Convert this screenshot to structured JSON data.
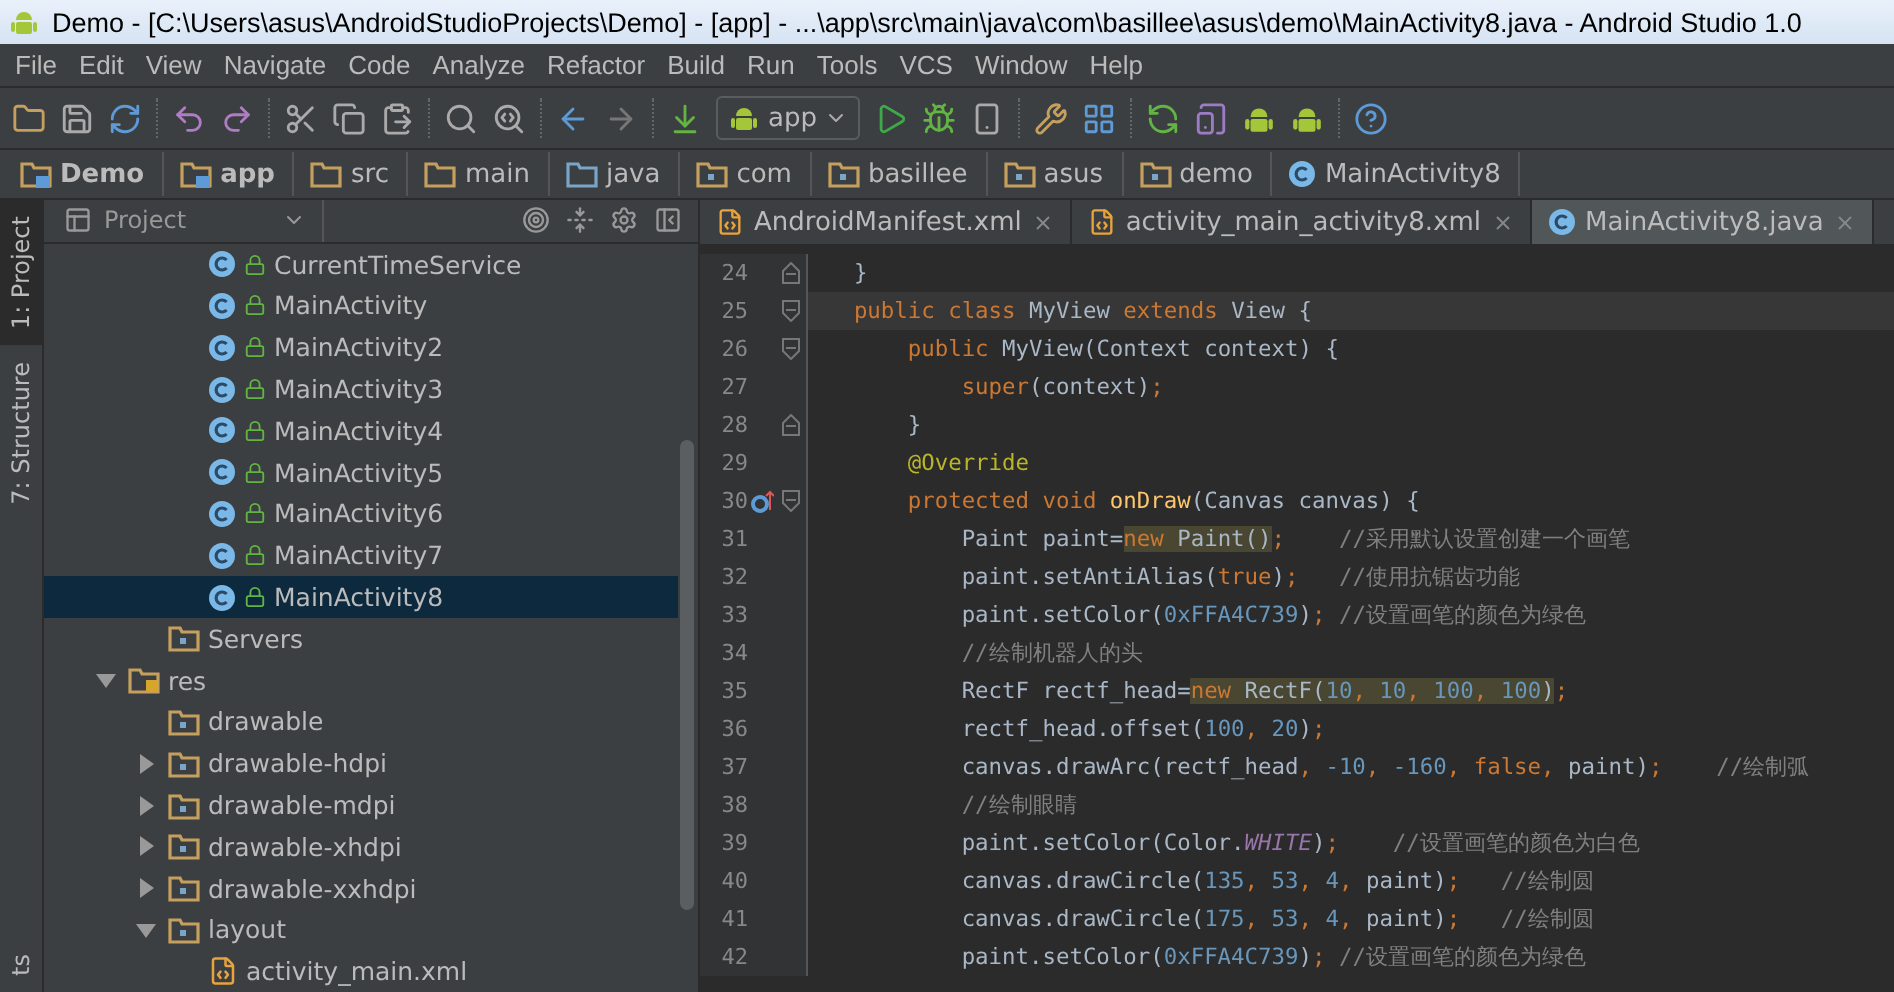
{
  "window": {
    "title": "Demo - [C:\\Users\\asus\\AndroidStudioProjects\\Demo] - [app] - ...\\app\\src\\main\\java\\com\\basillee\\asus\\demo\\MainActivity8.java - Android Studio 1.0"
  },
  "menu": [
    "File",
    "Edit",
    "View",
    "Navigate",
    "Code",
    "Analyze",
    "Refactor",
    "Build",
    "Run",
    "Tools",
    "VCS",
    "Window",
    "Help"
  ],
  "toolbar": {
    "run_config": "app"
  },
  "breadcrumbs": [
    {
      "label": "Demo",
      "kind": "module"
    },
    {
      "label": "app",
      "kind": "module"
    },
    {
      "label": "src",
      "kind": "folder"
    },
    {
      "label": "main",
      "kind": "folder"
    },
    {
      "label": "java",
      "kind": "source"
    },
    {
      "label": "com",
      "kind": "package"
    },
    {
      "label": "basillee",
      "kind": "package"
    },
    {
      "label": "asus",
      "kind": "package"
    },
    {
      "label": "demo",
      "kind": "package"
    },
    {
      "label": "MainActivity8",
      "kind": "class"
    }
  ],
  "tool_windows": [
    {
      "label": "1: Project",
      "selected": true
    },
    {
      "label": "7: Structure",
      "selected": false
    }
  ],
  "bottom_tool_windows": [
    {
      "label": "ts",
      "selected": false
    }
  ],
  "project_panel": {
    "title": "Project",
    "tree": [
      {
        "kind": "cut_off",
        "children": [
          {
            "kind": "cut_off",
            "children": [
              {
                "label": "CurrentTimeService",
                "kind": "class",
                "selected": false
              },
              {
                "label": "MainActivity",
                "kind": "class",
                "selected": false
              },
              {
                "label": "MainActivity2",
                "kind": "class",
                "selected": false
              },
              {
                "label": "MainActivity3",
                "kind": "class",
                "selected": false
              },
              {
                "label": "MainActivity4",
                "kind": "class",
                "selected": false
              },
              {
                "label": "MainActivity5",
                "kind": "class",
                "selected": false
              },
              {
                "label": "MainActivity6",
                "kind": "class",
                "selected": false
              },
              {
                "label": "MainActivity7",
                "kind": "class",
                "selected": false
              },
              {
                "label": "MainActivity8",
                "kind": "class",
                "selected": true
              }
            ]
          },
          {
            "label": "Servers",
            "kind": "package",
            "selected": false
          }
        ]
      },
      {
        "label": "res",
        "kind": "res",
        "expanded": true,
        "selected": false,
        "children": [
          {
            "label": "drawable",
            "kind": "package",
            "selected": false
          },
          {
            "label": "drawable-hdpi",
            "kind": "package",
            "expanded": false,
            "selected": false
          },
          {
            "label": "drawable-mdpi",
            "kind": "package",
            "expanded": false,
            "selected": false
          },
          {
            "label": "drawable-xhdpi",
            "kind": "package",
            "expanded": false,
            "selected": false
          },
          {
            "label": "drawable-xxhdpi",
            "kind": "package",
            "expanded": false,
            "selected": false
          },
          {
            "label": "layout",
            "kind": "package",
            "expanded": true,
            "selected": false,
            "children": [
              {
                "label": "activity_main.xml",
                "kind": "xml",
                "selected": false
              }
            ]
          }
        ]
      }
    ]
  },
  "editor": {
    "tabs": [
      {
        "label": "AndroidManifest.xml",
        "kind": "xml",
        "selected": false
      },
      {
        "label": "activity_main_activity8.xml",
        "kind": "xml",
        "selected": false
      },
      {
        "label": "MainActivity8.java",
        "kind": "class",
        "selected": true
      }
    ],
    "lines": [
      {
        "number": "24",
        "fold_start": false,
        "override": false,
        "current": false,
        "segments": [
          {
            "t": "    }",
            "kind": "plain"
          }
        ]
      },
      {
        "number": "25",
        "fold_start": true,
        "override": false,
        "current": true,
        "segments": [
          {
            "t": "    public class ",
            "kind": "kw"
          },
          {
            "t": "MyView",
            "kind": "plain"
          },
          {
            "t": " extends ",
            "kind": "kw"
          },
          {
            "t": "View {",
            "kind": "plain"
          }
        ]
      },
      {
        "number": "26",
        "fold_start": true,
        "override": false,
        "current": false,
        "segments": [
          {
            "t": "        public ",
            "kind": "kw"
          },
          {
            "t": "MyView(Context context) {",
            "kind": "plain"
          }
        ]
      },
      {
        "number": "27",
        "override": false,
        "current": false,
        "segments": [
          {
            "t": "            super",
            "kind": "kw"
          },
          {
            "t": "(context)",
            "kind": "plain"
          },
          {
            "t": ";",
            "kind": "kw"
          }
        ]
      },
      {
        "number": "28",
        "fold_start": false,
        "override": false,
        "current": false,
        "segments": [
          {
            "t": "        }",
            "kind": "plain"
          }
        ]
      },
      {
        "number": "29",
        "override": false,
        "current": false,
        "segments": [
          {
            "t": "        @Override",
            "kind": "anno"
          }
        ]
      },
      {
        "number": "30",
        "fold_start": true,
        "override": true,
        "current": false,
        "segments": [
          {
            "t": "        protected void ",
            "kind": "kw"
          },
          {
            "t": "onDraw",
            "kind": "method"
          },
          {
            "t": "(Canvas canvas) {",
            "kind": "plain"
          }
        ]
      },
      {
        "number": "31",
        "override": false,
        "current": false,
        "segments": [
          {
            "t": "            Paint paint=",
            "kind": "plain"
          },
          {
            "t": "new ",
            "kind": "hl_kw"
          },
          {
            "t": "Paint()",
            "kind": "hl_plain"
          },
          {
            "t": ";",
            "kind": "kw"
          },
          {
            "t": "    //采用默认设置创建一个画笔",
            "kind": "comment"
          }
        ]
      },
      {
        "number": "32",
        "override": false,
        "current": false,
        "segments": [
          {
            "t": "            paint.setAntiAlias(",
            "kind": "plain"
          },
          {
            "t": "true",
            "kind": "kw"
          },
          {
            "t": ")",
            "kind": "plain"
          },
          {
            "t": ";",
            "kind": "kw"
          },
          {
            "t": "   //使用抗锯齿功能",
            "kind": "comment"
          }
        ]
      },
      {
        "number": "33",
        "override": false,
        "current": false,
        "segments": [
          {
            "t": "            paint.setColor(",
            "kind": "plain"
          },
          {
            "t": "0xFFA4C739",
            "kind": "num"
          },
          {
            "t": ")",
            "kind": "plain"
          },
          {
            "t": ";",
            "kind": "kw"
          },
          {
            "t": " //设置画笔的颜色为绿色",
            "kind": "comment"
          }
        ]
      },
      {
        "number": "34",
        "override": false,
        "current": false,
        "segments": [
          {
            "t": "            //绘制机器人的头",
            "kind": "comment"
          }
        ]
      },
      {
        "number": "35",
        "override": false,
        "current": false,
        "segments": [
          {
            "t": "            RectF rectf_head=",
            "kind": "plain"
          },
          {
            "t": "new ",
            "kind": "hl_kw"
          },
          {
            "t": "RectF(",
            "kind": "hl_plain"
          },
          {
            "t": "10",
            "kind": "hl_num"
          },
          {
            "t": ", ",
            "kind": "hl_kw"
          },
          {
            "t": "10",
            "kind": "hl_num"
          },
          {
            "t": ", ",
            "kind": "hl_kw"
          },
          {
            "t": "100",
            "kind": "hl_num"
          },
          {
            "t": ", ",
            "kind": "hl_kw"
          },
          {
            "t": "100",
            "kind": "hl_num"
          },
          {
            "t": ")",
            "kind": "hl_plain"
          },
          {
            "t": ";",
            "kind": "kw"
          }
        ]
      },
      {
        "number": "36",
        "override": false,
        "current": false,
        "segments": [
          {
            "t": "            rectf_head.offset(",
            "kind": "plain"
          },
          {
            "t": "100",
            "kind": "num"
          },
          {
            "t": ", ",
            "kind": "kw"
          },
          {
            "t": "20",
            "kind": "num"
          },
          {
            "t": ")",
            "kind": "plain"
          },
          {
            "t": ";",
            "kind": "kw"
          }
        ]
      },
      {
        "number": "37",
        "override": false,
        "current": false,
        "segments": [
          {
            "t": "            canvas.drawArc(rectf_head",
            "kind": "plain"
          },
          {
            "t": ", ",
            "kind": "kw"
          },
          {
            "t": "-10",
            "kind": "num"
          },
          {
            "t": ", ",
            "kind": "kw"
          },
          {
            "t": "-160",
            "kind": "num"
          },
          {
            "t": ", ",
            "kind": "kw"
          },
          {
            "t": "false",
            "kind": "kw"
          },
          {
            "t": ", ",
            "kind": "kw"
          },
          {
            "t": "paint)",
            "kind": "plain"
          },
          {
            "t": ";",
            "kind": "kw"
          },
          {
            "t": "    //绘制弧",
            "kind": "comment"
          }
        ]
      },
      {
        "number": "38",
        "override": false,
        "current": false,
        "segments": [
          {
            "t": "            //绘制眼睛",
            "kind": "comment"
          }
        ]
      },
      {
        "number": "39",
        "override": false,
        "current": false,
        "segments": [
          {
            "t": "            paint.setColor(Color.",
            "kind": "plain"
          },
          {
            "t": "WHITE",
            "kind": "const"
          },
          {
            "t": ")",
            "kind": "plain"
          },
          {
            "t": ";",
            "kind": "kw"
          },
          {
            "t": "    //设置画笔的颜色为白色",
            "kind": "comment"
          }
        ]
      },
      {
        "number": "40",
        "override": false,
        "current": false,
        "segments": [
          {
            "t": "            canvas.drawCircle(",
            "kind": "plain"
          },
          {
            "t": "135",
            "kind": "num"
          },
          {
            "t": ", ",
            "kind": "kw"
          },
          {
            "t": "53",
            "kind": "num"
          },
          {
            "t": ", ",
            "kind": "kw"
          },
          {
            "t": "4",
            "kind": "num"
          },
          {
            "t": ", ",
            "kind": "kw"
          },
          {
            "t": "paint)",
            "kind": "plain"
          },
          {
            "t": ";",
            "kind": "kw"
          },
          {
            "t": "   //绘制圆",
            "kind": "comment"
          }
        ]
      },
      {
        "number": "41",
        "override": false,
        "current": false,
        "segments": [
          {
            "t": "            canvas.drawCircle(",
            "kind": "plain"
          },
          {
            "t": "175",
            "kind": "num"
          },
          {
            "t": ", ",
            "kind": "kw"
          },
          {
            "t": "53",
            "kind": "num"
          },
          {
            "t": ", ",
            "kind": "kw"
          },
          {
            "t": "4",
            "kind": "num"
          },
          {
            "t": ", ",
            "kind": "kw"
          },
          {
            "t": "paint)",
            "kind": "plain"
          },
          {
            "t": ";",
            "kind": "kw"
          },
          {
            "t": "   //绘制圆",
            "kind": "comment"
          }
        ]
      },
      {
        "number": "42",
        "override": false,
        "current": false,
        "segments": [
          {
            "t": "            paint.setColor(",
            "kind": "plain"
          },
          {
            "t": "0xFFA4C739",
            "kind": "num"
          },
          {
            "t": ")",
            "kind": "plain"
          },
          {
            "t": ";",
            "kind": "kw"
          },
          {
            "t": " //设置画笔的颜色为绿色",
            "kind": "comment"
          }
        ]
      }
    ]
  }
}
